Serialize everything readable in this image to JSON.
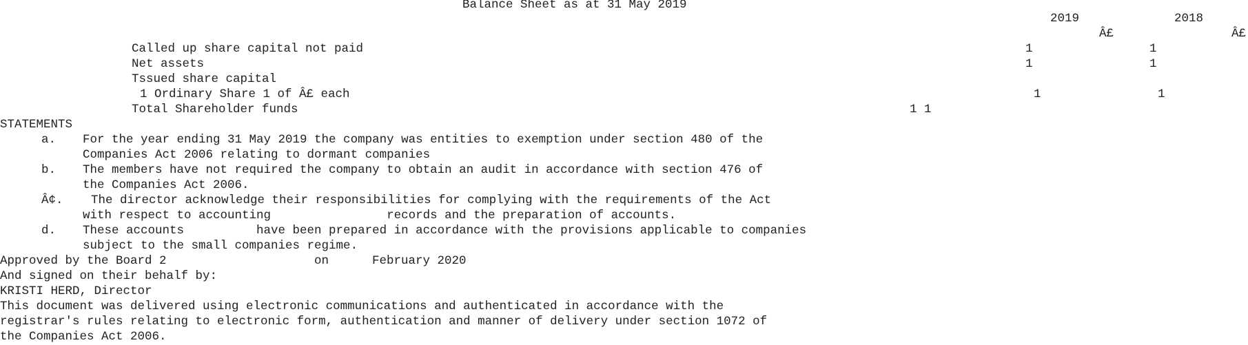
{
  "document": {
    "title": "Balance Sheet as at 31 May 2019",
    "year_current": "2019",
    "year_prior": "2018",
    "currency_current": "Â£",
    "currency_prior": "Â£",
    "rows": {
      "called_up": {
        "label": "Called up share capital not paid",
        "current": "1",
        "prior": "1"
      },
      "net_assets": {
        "label": "Net assets",
        "current": "1",
        "prior": "1"
      },
      "issued_heading": {
        "label": "Tssued share capital"
      },
      "ordinary_share": {
        "label": "1 Ordinary Share 1 of Â£ each",
        "current": "1",
        "prior": "1"
      },
      "total_funds": {
        "label": "Total Shareholder funds",
        "value": "1 1"
      }
    },
    "statements": {
      "heading": "STATEMENTS",
      "a": {
        "marker": "a.",
        "line1": "For the year ending 31 May 2019 the company was entities to exemption under section 480 of the",
        "line2": "Companies Act 2006 relating to dormant companies"
      },
      "b": {
        "marker": "b.",
        "line1": "The members have not required the company to obtain an audit in accordance with section 476 of",
        "line2": "the Companies Act 2006."
      },
      "c": {
        "marker": "Â¢.",
        "line1": "The director acknowledge their responsibilities for complying with the requirements of the Act",
        "line2": "with respect to accounting                records and the preparation of accounts."
      },
      "d": {
        "marker": "d.",
        "line1": "These accounts          have been prepared in accordance with the provisions applicable to companies",
        "line2": "subject to the small companies regime."
      }
    },
    "approval": {
      "approved_text": "Approved by the Board 2",
      "on_text": "on",
      "date_text": "February 2020",
      "signed_text": "And signed on their behalf by:",
      "director": "KRISTI HERD, Director"
    },
    "footer": {
      "line1": "This document was delivered using electronic communications and authenticated in accordance with the",
      "line2": "registrar's rules relating to electronic form, authentication and manner of delivery under section 1072 of",
      "line3": "the Companies Act 2006."
    }
  }
}
